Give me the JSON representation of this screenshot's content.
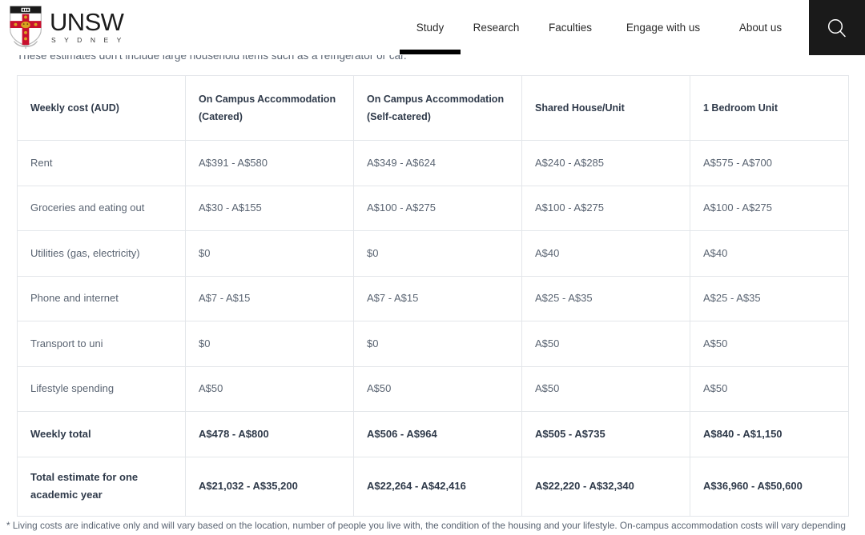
{
  "header": {
    "logo": {
      "name": "unsw-logo",
      "wordmark": "UNSW",
      "sublabel": "S Y D N E Y"
    },
    "nav": {
      "items": [
        {
          "label": "Study",
          "active": true
        },
        {
          "label": "Research",
          "active": false
        },
        {
          "label": "Faculties",
          "active": false
        },
        {
          "label": "Engage with us",
          "active": false
        },
        {
          "label": "About us",
          "active": false
        }
      ]
    },
    "search": {
      "icon": "search-icon",
      "background": "#1a1a1a"
    }
  },
  "main": {
    "intro_note": "These estimates don't include large household items such as a refrigerator or car.",
    "table": {
      "headers": [
        {
          "line1": "Weekly cost (AUD)",
          "line2": ""
        },
        {
          "line1": "On Campus Accommodation",
          "line2": "(Catered)"
        },
        {
          "line1": "On Campus Accommodation",
          "line2": "(Self-catered)"
        },
        {
          "line1": "Shared House/Unit",
          "line2": ""
        },
        {
          "line1": "1 Bedroom Unit",
          "line2": ""
        }
      ],
      "rows": [
        {
          "label": "Rent",
          "total": false,
          "values": [
            "A$391 - A$580",
            "A$349 - A$624",
            "A$240 - A$285",
            "A$575 - A$700"
          ]
        },
        {
          "label": "Groceries and eating out",
          "total": false,
          "values": [
            "A$30 - A$155",
            "A$100 - A$275",
            "A$100 - A$275",
            "A$100 - A$275"
          ]
        },
        {
          "label": "Utilities (gas, electricity)",
          "total": false,
          "values": [
            "$0",
            "$0",
            "A$40",
            "A$40"
          ]
        },
        {
          "label": "Phone and internet",
          "total": false,
          "values": [
            "A$7 - A$15",
            "A$7 - A$15",
            "A$25 - A$35",
            "A$25 - A$35"
          ]
        },
        {
          "label": "Transport to uni",
          "total": false,
          "values": [
            "$0",
            "$0",
            "A$50",
            "A$50"
          ]
        },
        {
          "label": "Lifestyle spending",
          "total": false,
          "values": [
            "A$50",
            "A$50",
            "A$50",
            "A$50"
          ]
        },
        {
          "label": "Weekly total",
          "total": true,
          "values": [
            "A$478 - A$800",
            "A$506 - A$964",
            "A$505 - A$735",
            "A$840 - A$1,150"
          ]
        },
        {
          "label": "Total estimate for one academic year",
          "total": true,
          "tall": true,
          "values": [
            "A$21,032 - A$35,200",
            "A$22,264 - A$42,416",
            "A$22,220 - A$32,340",
            "A$36,960 - A$50,600"
          ]
        }
      ]
    },
    "footnote": "* Living costs are indicative only and will vary based on the location, number of people you live with, the condition of the housing and your lifestyle. On-campus accommodation costs will vary depending"
  },
  "colors": {
    "text_primary": "#2f3a4a",
    "text_secondary": "#5a6472",
    "border": "#e3e6ea",
    "accent_dark": "#1a1a1a",
    "crest_red": "#c8102e"
  }
}
